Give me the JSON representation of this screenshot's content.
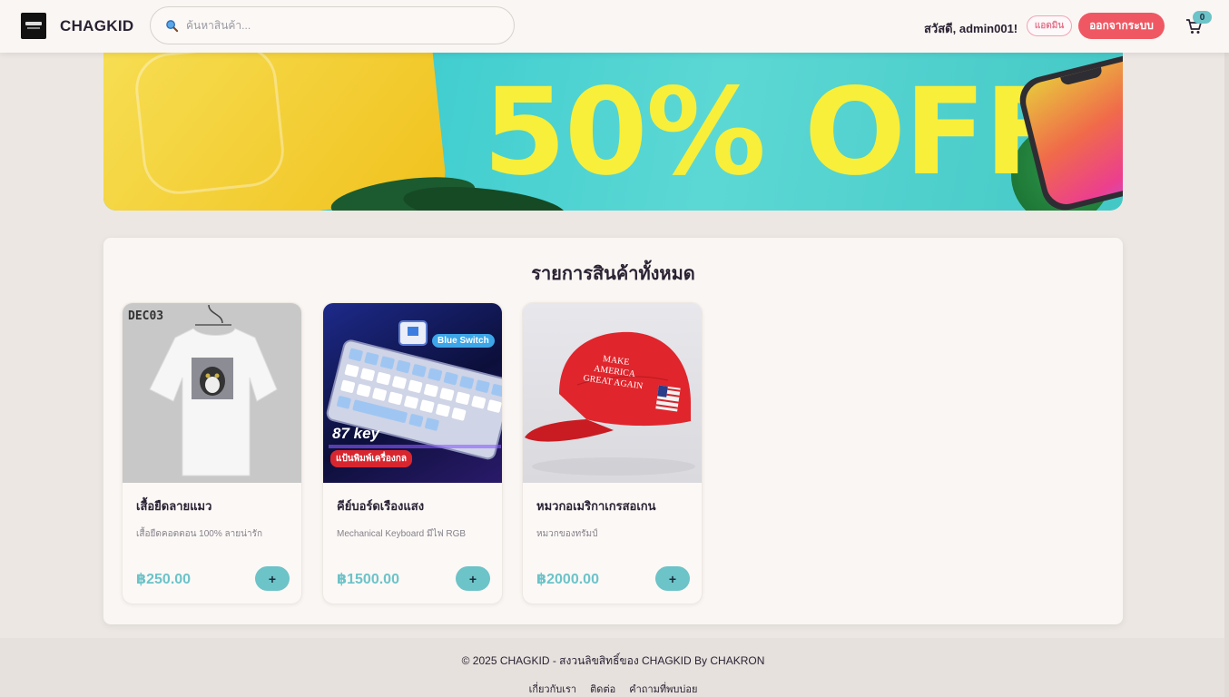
{
  "header": {
    "brand": "CHAGKID",
    "logo_icon": "store-logo-icon",
    "search": {
      "placeholder": "ค้นหาสินค้า..."
    },
    "greeting": "สวัสดี, admin001!",
    "admin_label": "แอดมิน",
    "logout_label": "ออกจากระบบ",
    "cart_count": "0"
  },
  "banner": {
    "text": "50% OFF"
  },
  "products": {
    "title": "รายการสินค้าทั้งหมด",
    "items": [
      {
        "name": "เสื้อยืดลายแมว",
        "description": "เสื้อยืดคอตตอน 100% ลายน่ารัก",
        "price": "฿250.00",
        "add_label": "+",
        "image_text": "DEC03"
      },
      {
        "name": "คีย์บอร์ดเรืองแสง",
        "description": "Mechanical Keyboard มีไฟ RGB",
        "price": "฿1500.00",
        "add_label": "+",
        "image_text": {
          "switch": "Blue Switch",
          "keys": "87 key",
          "tag": "แป้นพิมพ์เครื่องกล"
        }
      },
      {
        "name": "หมวกอเมริกาเกรสอเกน",
        "description": "หมวกของทรัมป์",
        "price": "฿2000.00",
        "add_label": "+",
        "image_text": "MAKE AMERICA GREAT AGAIN"
      }
    ]
  },
  "footer": {
    "copyright": "© 2025 CHAGKID - สงวนลิขสิทธิ์ของ CHAGKID By CHAKRON",
    "links": [
      "เกี่ยวกับเรา",
      "ติดต่อ",
      "คำถามที่พบบ่อย"
    ]
  },
  "colors": {
    "accent": "#6cc3c8",
    "logout": "#ef5863",
    "admin_border": "#f0a5b5",
    "background": "#ece7e3"
  }
}
